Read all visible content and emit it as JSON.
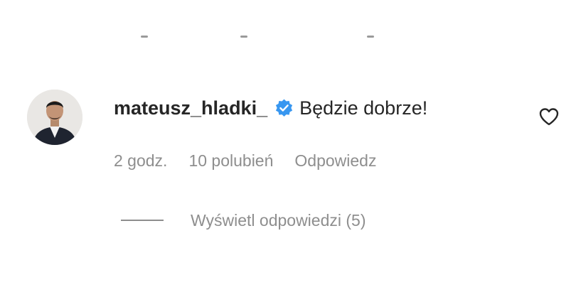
{
  "comment": {
    "username": "mateusz_hladki_",
    "verified_icon": "verified-badge-icon",
    "text": "Będzie dobrze!",
    "like_icon": "heart-outline-icon",
    "time": "2 godz.",
    "likes": "10 polubień",
    "reply_label": "Odpowiedz",
    "view_replies_label": "Wyświetl odpowiedzi (5)"
  },
  "colors": {
    "primary_text": "#262626",
    "secondary_text": "#8e8e8e",
    "verified_blue": "#3897f0",
    "background": "#ffffff"
  }
}
